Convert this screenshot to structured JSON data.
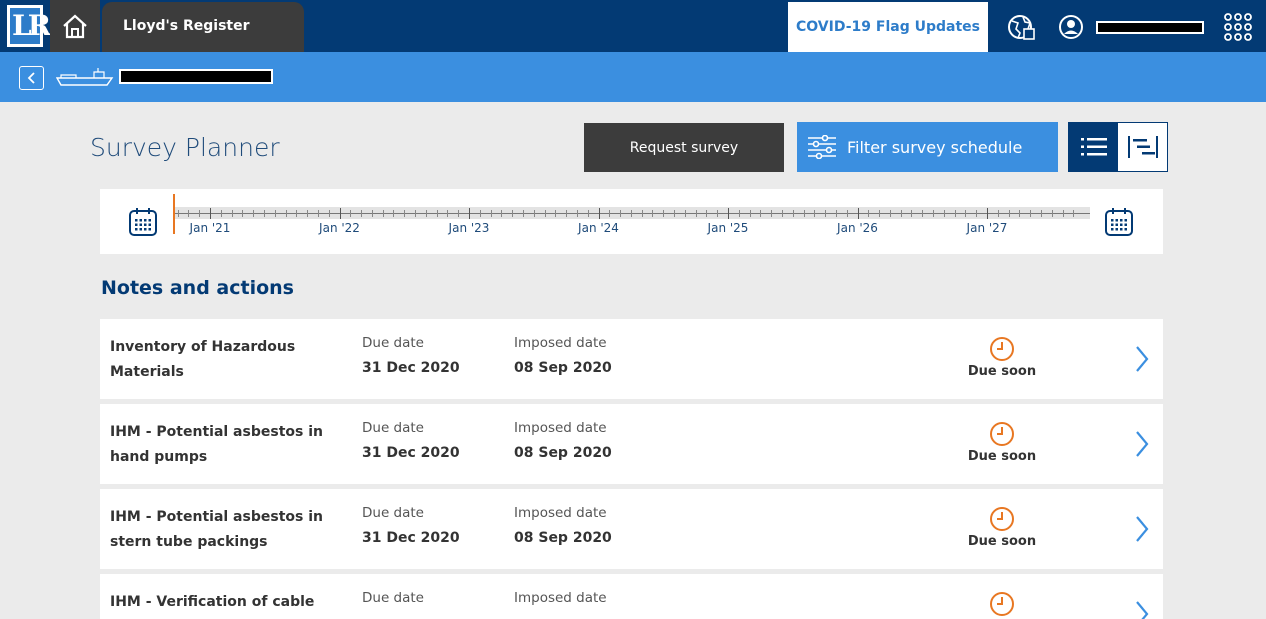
{
  "header": {
    "brand": "Lloyd's Register",
    "logo_text": "LR",
    "covid_tab": "COVID-19 Flag Updates",
    "icons": {
      "home": "home-icon",
      "globe": "globe-icon",
      "user": "user-icon",
      "apps": "apps-grid-icon"
    }
  },
  "shipbar": {
    "icons": {
      "back": "chevron-left-icon",
      "ship": "ship-icon"
    }
  },
  "page": {
    "title": "Survey Planner",
    "request_button": "Request survey",
    "filter_button": "Filter survey schedule",
    "view_toggle": {
      "selected": "list"
    }
  },
  "timeline": {
    "years": [
      "Jan '21",
      "Jan '22",
      "Jan '23",
      "Jan '24",
      "Jan '25",
      "Jan '26",
      "Jan '27"
    ]
  },
  "notes": {
    "section_title": "Notes and actions",
    "due_label": "Due date",
    "imposed_label": "Imposed date",
    "items": [
      {
        "title": "Inventory of Hazardous Materials",
        "due": "31 Dec 2020",
        "imposed": "08 Sep 2020",
        "status": "Due soon"
      },
      {
        "title": "IHM - Potential asbestos in hand pumps",
        "due": "31 Dec 2020",
        "imposed": "08 Sep 2020",
        "status": "Due soon"
      },
      {
        "title": "IHM - Potential asbestos in stern tube packings",
        "due": "31 Dec 2020",
        "imposed": "08 Sep 2020",
        "status": "Due soon"
      },
      {
        "title": "IHM - Verification of cable",
        "due": "",
        "imposed": "",
        "status": ""
      }
    ]
  },
  "colors": {
    "navy": "#033a74",
    "blue": "#3b8fe0",
    "dark": "#3c3c3c",
    "orange": "#e87722"
  }
}
